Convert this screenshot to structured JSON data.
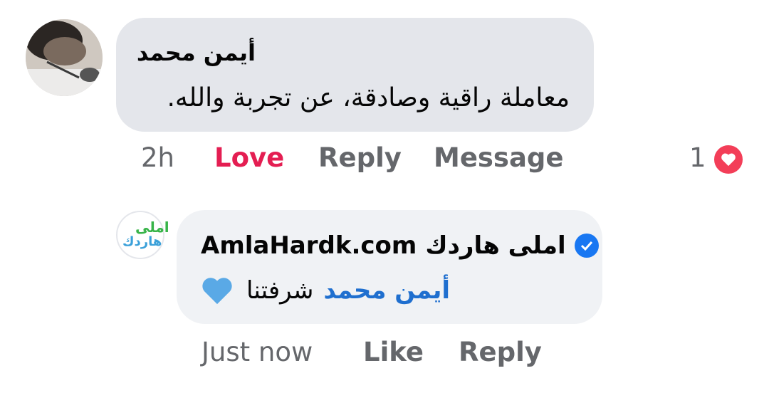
{
  "comment": {
    "author": "أيمن محمد",
    "text": "معاملة راقية وصادقة، عن تجربة والله.",
    "time": "2h",
    "love_label": "Love",
    "reply_label": "Reply",
    "message_label": "Message",
    "reaction_count": "1",
    "reaction_icon": "heart-icon",
    "love_color": "#e41e52"
  },
  "reply": {
    "author": "املى هاردك AmlaHardk.com",
    "author_arabic": "املى هاردك",
    "author_latin": "AmlaHardk.com",
    "verified_icon": "verified-badge-icon",
    "mention": "أيمن محمد",
    "text": "شرفتنا",
    "emoji": "blue-heart-icon",
    "time": "Just now",
    "like_label": "Like",
    "reply_label": "Reply",
    "logo_line1": "املى",
    "logo_line2": "هاردك"
  }
}
